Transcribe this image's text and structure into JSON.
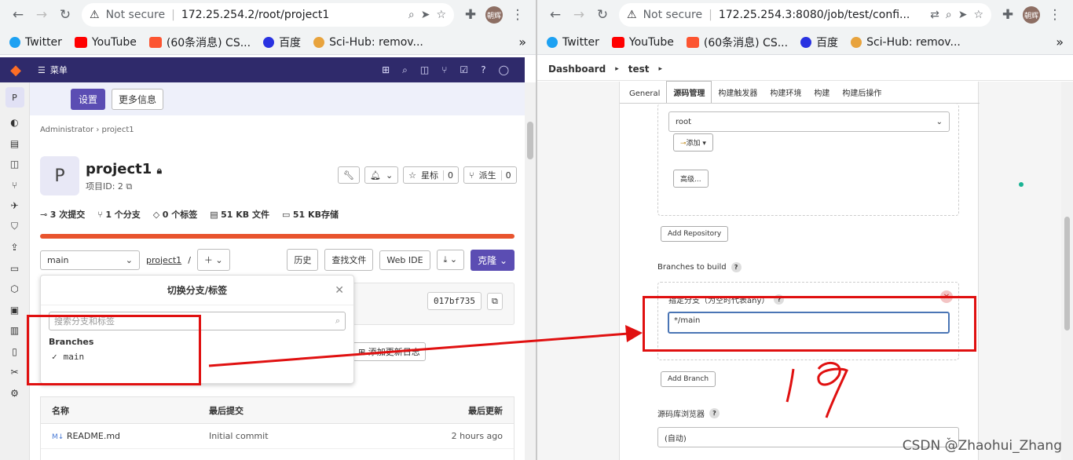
{
  "left": {
    "url": "172.25.254.2/root/project1",
    "not_secure": "Not secure",
    "avatar": "朝辉",
    "bookmarks": [
      "Twitter",
      "YouTube",
      "(60条消息) CS...",
      "百度",
      "Sci-Hub: remov..."
    ],
    "gitlab": {
      "menu": "菜单",
      "banner_buttons": [
        "设置",
        "更多信息"
      ],
      "breadcrumb": [
        "Administrator",
        "project1"
      ],
      "avatar_letter": "P",
      "project_name": "project1",
      "project_id": "项目ID: 2",
      "actions": {
        "star": "星标",
        "star_count": "0",
        "fork": "派生",
        "fork_count": "0"
      },
      "stats": [
        "3 次提交",
        "1 个分支",
        "0 个标签",
        "51 KB 文件",
        "51 KB存储"
      ],
      "branch": "main",
      "path": "project1",
      "path_sep": "/",
      "buttons": [
        "历史",
        "查找文件",
        "Web IDE"
      ],
      "clone": "克隆",
      "commit_hash": "017bf735",
      "changelog": "添加更新日志",
      "dropdown": {
        "title": "切换分支/标签",
        "search_placeholder": "搜索分支和标签",
        "section": "Branches",
        "option": "main"
      },
      "table": {
        "headers": [
          "名称",
          "最后提交",
          "最后更新"
        ],
        "rows": [
          [
            "README.md",
            "Initial commit",
            "2 hours ago"
          ]
        ]
      }
    }
  },
  "right": {
    "url": "172.25.254.3:8080/job/test/confi...",
    "not_secure": "Not secure",
    "avatar": "朝辉",
    "bookmarks": [
      "Twitter",
      "YouTube",
      "(60条消息) CS...",
      "百度",
      "Sci-Hub: remov..."
    ],
    "breadcrumb": [
      "Dashboard",
      "test"
    ],
    "tabs": [
      "General",
      "源码管理",
      "构建触发器",
      "构建环境",
      "构建",
      "构建后操作"
    ],
    "credentials": "root",
    "add_button": "添加",
    "advanced_button": "高级...",
    "add_repository": "Add Repository",
    "branches_label": "Branches to build",
    "branch_specifier_label": "指定分支（为空时代表any）",
    "branch_value": "*/main",
    "add_branch": "Add Branch",
    "browser_label": "源码库浏览器",
    "browser_value": "(自动)",
    "handwriting": "17"
  },
  "watermark": "CSDN @Zhaohui_Zhang",
  "colors": {
    "annotation": "#e01010",
    "gitlab_nav": "#2f2a6b",
    "gitlab_primary": "#5b4db3"
  }
}
